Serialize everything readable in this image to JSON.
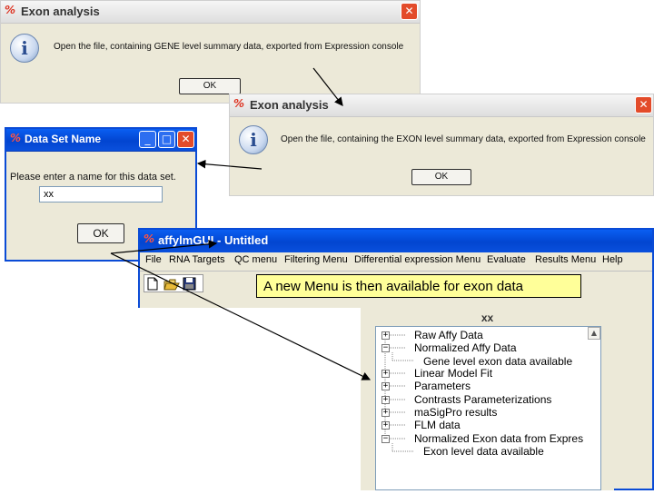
{
  "dialog1": {
    "title": "Exon analysis",
    "title_icon": "app-icon",
    "message": "Open the file, containing GENE level summary data, exported from Expression console",
    "ok_label": "OK",
    "close_symbol": "✕"
  },
  "dialog2": {
    "title": "Exon analysis",
    "title_icon": "app-icon",
    "message": "Open the file, containing the EXON level summary data, exported from Expression console",
    "ok_label": "OK",
    "close_symbol": "✕"
  },
  "dialog3": {
    "title": "Data Set Name",
    "prompt": "Please enter a name for this data set.",
    "input_value": "xx",
    "ok_label": "OK",
    "minimize_symbol": "_",
    "maximize_symbol": "□",
    "close_symbol": "✕"
  },
  "main_window": {
    "title": "affylmGUI - Untitled",
    "menu": [
      "File",
      "RNA Targets",
      "QC menu",
      "Filtering Menu",
      "Differential expression Menu",
      "Evaluate",
      "Results Menu",
      "Help"
    ],
    "toolbar_icons": [
      "new-file-icon",
      "open-folder-icon",
      "save-icon"
    ],
    "callout": "A new Menu is then available for exon data"
  },
  "tree_panel": {
    "title": "xx",
    "items": [
      {
        "label": "Raw Affy Data",
        "expander": "+"
      },
      {
        "label": "Normalized Affy Data",
        "expander": "−"
      },
      {
        "label": "Gene level exon data available",
        "expander": ""
      },
      {
        "label": "Linear Model Fit",
        "expander": "+"
      },
      {
        "label": "Parameters",
        "expander": "+"
      },
      {
        "label": "Contrasts Parameterizations",
        "expander": "+"
      },
      {
        "label": "maSigPro results",
        "expander": "+"
      },
      {
        "label": "FLM data",
        "expander": "+"
      },
      {
        "label": "Normalized Exon data from Expres",
        "expander": "−"
      },
      {
        "label": "Exon level data available",
        "expander": ""
      }
    ]
  },
  "colors": {
    "dialog_bg": "#ece9d8",
    "close_red": "#e34b2a",
    "titlebar_blue": "#0245d0",
    "callout_bg": "#ffff99"
  }
}
